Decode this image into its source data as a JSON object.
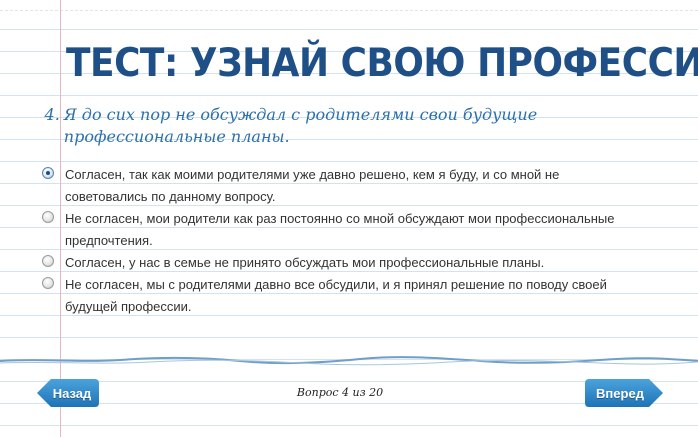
{
  "title": "ТЕСТ: УЗНАЙ СВОЮ ПРОФЕССИЮ!",
  "question": {
    "number": "4.",
    "text": "Я до сих пор не обсуждал с родителями свои будущие профессиональные планы."
  },
  "answers": [
    {
      "text": "Согласен, так как моими родителями уже давно решено, кем я буду, и со мной не советовались по данному вопросу.",
      "selected": true
    },
    {
      "text": "Не согласен, мои родители как раз постоянно со мной обсуждают мои профессиональные предпочтения.",
      "selected": false
    },
    {
      "text": "Согласен, у нас в семье не принято обсуждать мои профессиональные планы.",
      "selected": false
    },
    {
      "text": "Не согласен, мы с родителями давно все обсудили, и я принял решение по поводу своей будущей профессии.",
      "selected": false
    }
  ],
  "nav": {
    "back_label": "Назад",
    "next_label": "Вперед",
    "counter": "Вопрос 4 из 20"
  },
  "colors": {
    "title": "#1e4f87",
    "question": "#2b6fb0",
    "button_top": "#4ba3dd",
    "button_bottom": "#1e73b6",
    "ruled_line": "#d3e2ef",
    "margin_line": "#e7b6c4"
  }
}
